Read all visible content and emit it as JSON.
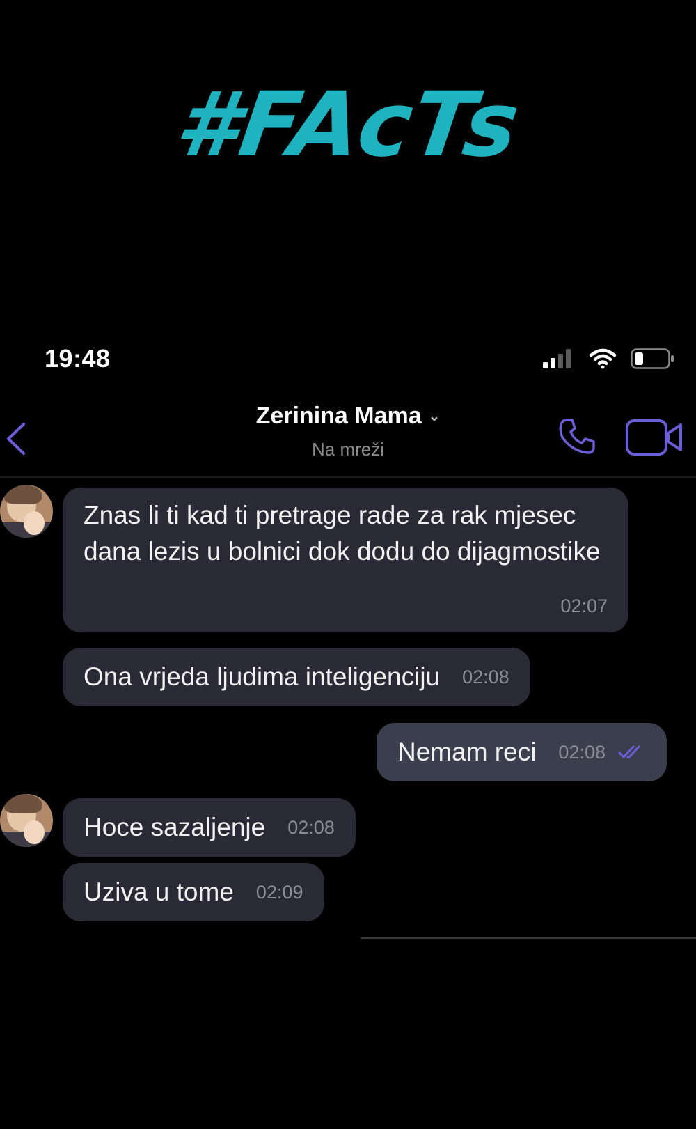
{
  "overlay": {
    "text": "#FAcTs"
  },
  "status_bar": {
    "time": "19:48"
  },
  "header": {
    "contact_name": "Zerinina Mama",
    "chevron": "⌄",
    "presence": "Na mreži"
  },
  "messages": [
    {
      "direction": "incoming",
      "text": "Znas li ti kad ti pretrage rade za rak mjesec dana lezis u bolnici dok dodu do dijagmostike",
      "time": "02:07"
    },
    {
      "direction": "incoming",
      "text": "Ona vrjeda ljudima inteligenciju",
      "time": "02:08"
    },
    {
      "direction": "outgoing",
      "text": "Nemam reci",
      "time": "02:08"
    },
    {
      "direction": "incoming",
      "text": "Hoce sazaljenje",
      "time": "02:08"
    },
    {
      "direction": "incoming",
      "text": "Uziva u tome",
      "time": "02:09"
    }
  ],
  "colors": {
    "accent": "#6b5fd8",
    "overlay_text": "#1fb3c0",
    "incoming_bubble": "#2a2a36",
    "outgoing_bubble": "#3b3e4c"
  },
  "icons": [
    "back-icon",
    "phone-icon",
    "video-camera-icon",
    "signal-icon",
    "wifi-icon",
    "battery-icon",
    "read-receipt-icon"
  ]
}
